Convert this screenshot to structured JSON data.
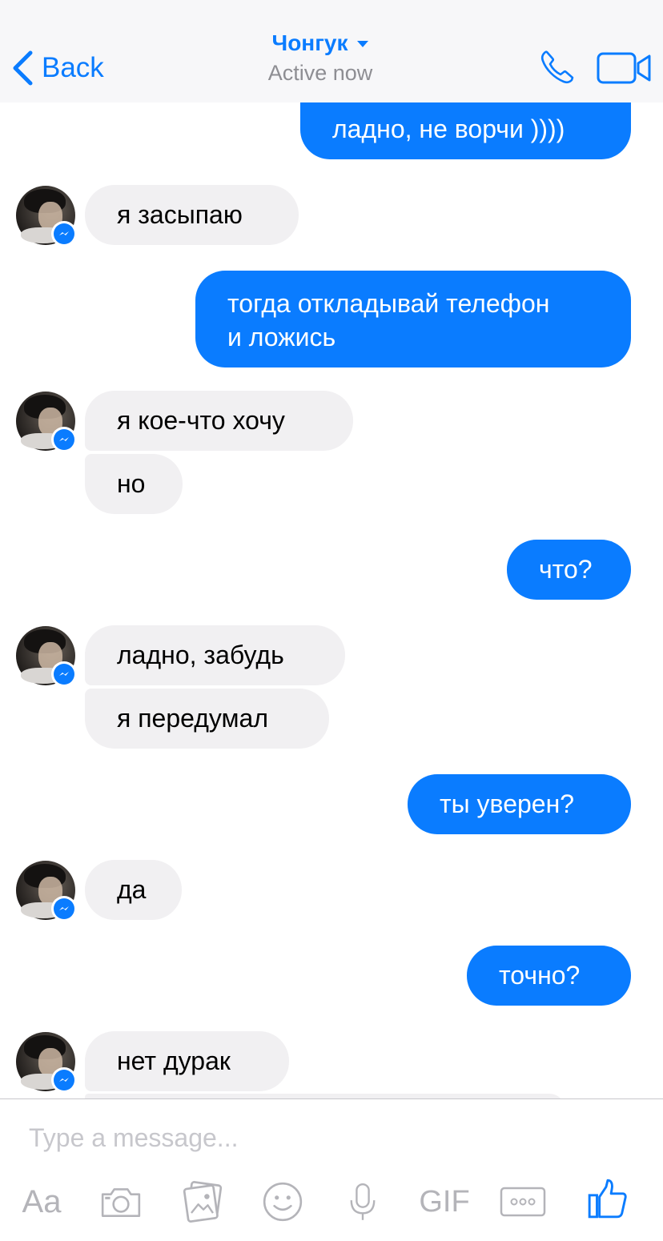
{
  "header": {
    "back_label": "Back",
    "contact_name": "Чонгук",
    "status": "Active now",
    "accent_color": "#0a7cff"
  },
  "messages": [
    {
      "from": "me",
      "text": "ладно, не ворчи ))))"
    },
    {
      "from": "contact",
      "text": "я засыпаю"
    },
    {
      "from": "me",
      "text": "тогда откладывай телефон",
      "text2": "и ложись"
    },
    {
      "from": "contact",
      "text": "я кое-что хочу"
    },
    {
      "from": "contact",
      "text": "но"
    },
    {
      "from": "me",
      "text": "что?"
    },
    {
      "from": "contact",
      "text": "ладно, забудь"
    },
    {
      "from": "contact",
      "text": "я передумал"
    },
    {
      "from": "me",
      "text": "ты уверен?"
    },
    {
      "from": "contact",
      "text": "да"
    },
    {
      "from": "me",
      "text": "точно?"
    },
    {
      "from": "contact",
      "text": "нет дурак"
    }
  ],
  "composer": {
    "placeholder": "Type a message...",
    "text_tool_label": "Aa",
    "gif_label": "GIF",
    "icons": [
      "text-icon",
      "camera-icon",
      "gallery-icon",
      "emoji-icon",
      "microphone-icon",
      "gif-icon",
      "more-icon",
      "like-icon"
    ]
  }
}
